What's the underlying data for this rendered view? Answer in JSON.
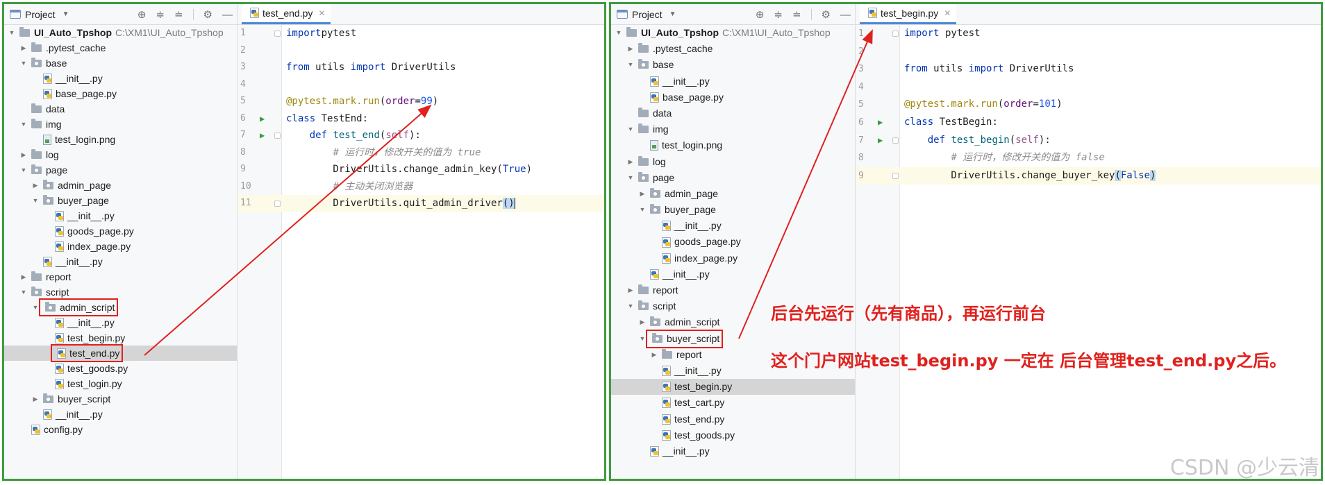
{
  "left": {
    "project_label": "Project",
    "tab": {
      "label": "test_end.py",
      "close_icon": "close-icon"
    },
    "root": {
      "name": "UI_Auto_Tpshop",
      "path": "C:\\XM1\\UI_Auto_Tpshop"
    },
    "tree": [
      {
        "label": ".pytest_cache",
        "indent": 1,
        "kind": "folder",
        "arrow": "right"
      },
      {
        "label": "base",
        "indent": 1,
        "kind": "pkg",
        "arrow": "down"
      },
      {
        "label": "__init__.py",
        "indent": 2,
        "kind": "py",
        "arrow": ""
      },
      {
        "label": "base_page.py",
        "indent": 2,
        "kind": "py",
        "arrow": ""
      },
      {
        "label": "data",
        "indent": 1,
        "kind": "folder",
        "arrow": ""
      },
      {
        "label": "img",
        "indent": 1,
        "kind": "folder",
        "arrow": "down"
      },
      {
        "label": "test_login.png",
        "indent": 2,
        "kind": "png",
        "arrow": ""
      },
      {
        "label": "log",
        "indent": 1,
        "kind": "folder",
        "arrow": "right"
      },
      {
        "label": "page",
        "indent": 1,
        "kind": "pkg",
        "arrow": "down"
      },
      {
        "label": "admin_page",
        "indent": 2,
        "kind": "pkg",
        "arrow": "right"
      },
      {
        "label": "buyer_page",
        "indent": 2,
        "kind": "pkg",
        "arrow": "down"
      },
      {
        "label": "__init__.py",
        "indent": 3,
        "kind": "py",
        "arrow": ""
      },
      {
        "label": "goods_page.py",
        "indent": 3,
        "kind": "py",
        "arrow": ""
      },
      {
        "label": "index_page.py",
        "indent": 3,
        "kind": "py",
        "arrow": ""
      },
      {
        "label": "__init__.py",
        "indent": 2,
        "kind": "py",
        "arrow": ""
      },
      {
        "label": "report",
        "indent": 1,
        "kind": "folder",
        "arrow": "right"
      },
      {
        "label": "script",
        "indent": 1,
        "kind": "pkg",
        "arrow": "down"
      },
      {
        "label": "admin_script",
        "indent": 2,
        "kind": "pkg",
        "arrow": "down",
        "boxed": true
      },
      {
        "label": "__init__.py",
        "indent": 3,
        "kind": "py",
        "arrow": ""
      },
      {
        "label": "test_begin.py",
        "indent": 3,
        "kind": "py",
        "arrow": ""
      },
      {
        "label": "test_end.py",
        "indent": 3,
        "kind": "py",
        "arrow": "",
        "boxed": true,
        "selected": true
      },
      {
        "label": "test_goods.py",
        "indent": 3,
        "kind": "py",
        "arrow": ""
      },
      {
        "label": "test_login.py",
        "indent": 3,
        "kind": "py",
        "arrow": ""
      },
      {
        "label": "buyer_script",
        "indent": 2,
        "kind": "pkg",
        "arrow": "right"
      },
      {
        "label": "__init__.py",
        "indent": 2,
        "kind": "py",
        "arrow": ""
      },
      {
        "label": "config.py",
        "indent": 1,
        "kind": "py",
        "arrow": ""
      }
    ],
    "code": [
      {
        "n": "1",
        "fold": true,
        "tokens": [
          [
            "kw",
            "import"
          ],
          [
            "",
            "pytest"
          ]
        ]
      },
      {
        "n": "2",
        "tokens": []
      },
      {
        "n": "3",
        "tokens": [
          [
            "kw",
            "from"
          ],
          [
            "",
            " utils "
          ],
          [
            "kw",
            "import"
          ],
          [
            "",
            " DriverUtils"
          ]
        ]
      },
      {
        "n": "4",
        "tokens": []
      },
      {
        "n": "5",
        "tokens": [
          [
            "dec",
            "@pytest.mark.run"
          ],
          [
            "",
            "("
          ],
          [
            "pname",
            "order"
          ],
          [
            "",
            "="
          ],
          [
            "num",
            "99"
          ],
          [
            "",
            ")"
          ]
        ]
      },
      {
        "n": "6",
        "run": true,
        "tokens": [
          [
            "kw",
            "class"
          ],
          [
            "",
            " TestEnd:"
          ]
        ]
      },
      {
        "n": "7",
        "run": true,
        "fold": true,
        "tokens": [
          [
            "",
            "    "
          ],
          [
            "kw",
            "def"
          ],
          [
            "",
            " "
          ],
          [
            "fn",
            "test_end"
          ],
          [
            "",
            "("
          ],
          [
            "self",
            "self"
          ],
          [
            "",
            "):"
          ]
        ]
      },
      {
        "n": "8",
        "tokens": [
          [
            "",
            "        "
          ],
          [
            "cmt",
            "# 运行时，修改开关的值为 true"
          ]
        ]
      },
      {
        "n": "9",
        "tokens": [
          [
            "",
            "        DriverUtils.change_admin_key("
          ],
          [
            "bool",
            "True"
          ],
          [
            "",
            ")"
          ]
        ]
      },
      {
        "n": "10",
        "tokens": [
          [
            "",
            "        "
          ],
          [
            "cmt",
            "# 主动关闭浏览器"
          ]
        ]
      },
      {
        "n": "11",
        "current": true,
        "fold": true,
        "tokens": [
          [
            "",
            "        DriverUtils.quit_admin_driver"
          ],
          [
            "brk",
            "()"
          ],
          [
            "caret",
            ""
          ]
        ]
      }
    ]
  },
  "right": {
    "project_label": "Project",
    "tab": {
      "label": "test_begin.py",
      "close_icon": "close-icon"
    },
    "root": {
      "name": "UI_Auto_Tpshop",
      "path": "C:\\XM1\\UI_Auto_Tpshop"
    },
    "tree": [
      {
        "label": ".pytest_cache",
        "indent": 1,
        "kind": "folder",
        "arrow": "right"
      },
      {
        "label": "base",
        "indent": 1,
        "kind": "pkg",
        "arrow": "down"
      },
      {
        "label": "__init__.py",
        "indent": 2,
        "kind": "py",
        "arrow": ""
      },
      {
        "label": "base_page.py",
        "indent": 2,
        "kind": "py",
        "arrow": ""
      },
      {
        "label": "data",
        "indent": 1,
        "kind": "folder",
        "arrow": ""
      },
      {
        "label": "img",
        "indent": 1,
        "kind": "folder",
        "arrow": "down"
      },
      {
        "label": "test_login.png",
        "indent": 2,
        "kind": "png",
        "arrow": ""
      },
      {
        "label": "log",
        "indent": 1,
        "kind": "folder",
        "arrow": "right"
      },
      {
        "label": "page",
        "indent": 1,
        "kind": "pkg",
        "arrow": "down"
      },
      {
        "label": "admin_page",
        "indent": 2,
        "kind": "pkg",
        "arrow": "right"
      },
      {
        "label": "buyer_page",
        "indent": 2,
        "kind": "pkg",
        "arrow": "down"
      },
      {
        "label": "__init__.py",
        "indent": 3,
        "kind": "py",
        "arrow": ""
      },
      {
        "label": "goods_page.py",
        "indent": 3,
        "kind": "py",
        "arrow": ""
      },
      {
        "label": "index_page.py",
        "indent": 3,
        "kind": "py",
        "arrow": ""
      },
      {
        "label": "__init__.py",
        "indent": 2,
        "kind": "py",
        "arrow": ""
      },
      {
        "label": "report",
        "indent": 1,
        "kind": "folder",
        "arrow": "right"
      },
      {
        "label": "script",
        "indent": 1,
        "kind": "pkg",
        "arrow": "down"
      },
      {
        "label": "admin_script",
        "indent": 2,
        "kind": "pkg",
        "arrow": "right"
      },
      {
        "label": "buyer_script",
        "indent": 2,
        "kind": "pkg",
        "arrow": "down",
        "boxed": true
      },
      {
        "label": "report",
        "indent": 3,
        "kind": "folder",
        "arrow": "right"
      },
      {
        "label": "__init__.py",
        "indent": 3,
        "kind": "py",
        "arrow": ""
      },
      {
        "label": "test_begin.py",
        "indent": 3,
        "kind": "py",
        "arrow": "",
        "selected": true
      },
      {
        "label": "test_cart.py",
        "indent": 3,
        "kind": "py",
        "arrow": ""
      },
      {
        "label": "test_end.py",
        "indent": 3,
        "kind": "py",
        "arrow": ""
      },
      {
        "label": "test_goods.py",
        "indent": 3,
        "kind": "py",
        "arrow": ""
      },
      {
        "label": "__init__.py",
        "indent": 2,
        "kind": "py",
        "arrow": ""
      }
    ],
    "code": [
      {
        "n": "1",
        "fold": true,
        "tokens": [
          [
            "kw",
            "import"
          ],
          [
            "",
            " pytest"
          ]
        ]
      },
      {
        "n": "2",
        "tokens": []
      },
      {
        "n": "3",
        "tokens": [
          [
            "kw",
            "from"
          ],
          [
            "",
            " utils "
          ],
          [
            "kw",
            "import"
          ],
          [
            "",
            " DriverUtils"
          ]
        ]
      },
      {
        "n": "4",
        "tokens": []
      },
      {
        "n": "5",
        "tokens": [
          [
            "dec",
            "@pytest.mark.run"
          ],
          [
            "",
            "("
          ],
          [
            "pname",
            "order"
          ],
          [
            "",
            "="
          ],
          [
            "num",
            "101"
          ],
          [
            "",
            ")"
          ]
        ]
      },
      {
        "n": "6",
        "run": true,
        "tokens": [
          [
            "kw",
            "class"
          ],
          [
            "",
            " TestBegin:"
          ]
        ]
      },
      {
        "n": "7",
        "run": true,
        "fold": true,
        "tokens": [
          [
            "",
            "    "
          ],
          [
            "kw",
            "def"
          ],
          [
            "",
            " "
          ],
          [
            "fn",
            "test_begin"
          ],
          [
            "",
            "("
          ],
          [
            "self",
            "self"
          ],
          [
            "",
            "):"
          ]
        ]
      },
      {
        "n": "8",
        "tokens": [
          [
            "",
            "        "
          ],
          [
            "cmt",
            "# 运行时，修改开关的值为 false"
          ]
        ]
      },
      {
        "n": "9",
        "current": true,
        "fold": true,
        "tokens": [
          [
            "",
            "        DriverUtils.change_buyer_key"
          ],
          [
            "brk",
            "("
          ],
          [
            "bool",
            "False"
          ],
          [
            "brk",
            ")"
          ]
        ]
      }
    ],
    "annotations": [
      "后台先运行（先有商品），再运行前台",
      "这个门户网站test_begin.py 一定在 后台管理test_end.py之后。"
    ]
  },
  "watermark": "CSDN @少云清",
  "colors": {
    "annotation_red": "#e0211d",
    "panel_border_green": "#3f9a3f",
    "selection_gray": "#d5d5d5",
    "tab_underline_blue": "#4a88d9"
  }
}
